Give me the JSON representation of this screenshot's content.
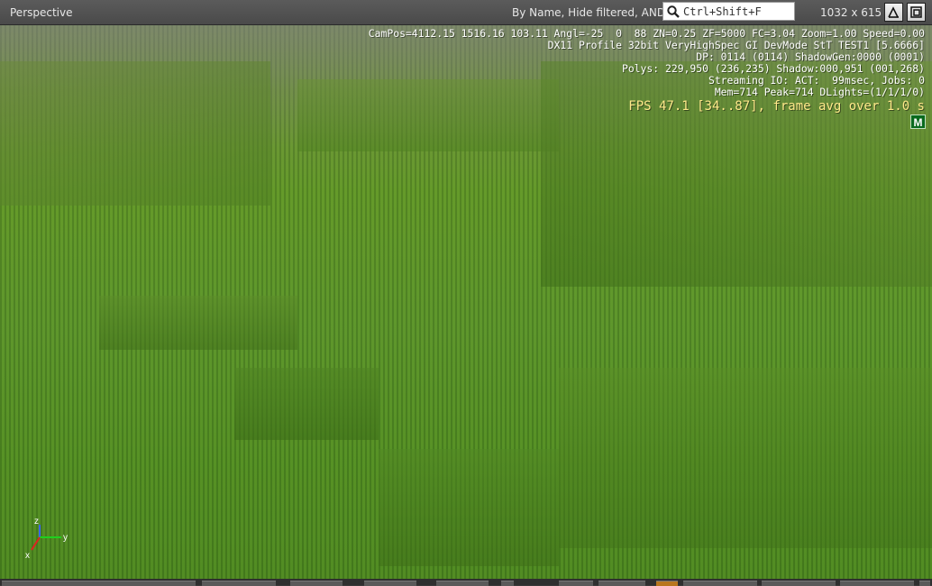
{
  "toolbar": {
    "view_title": "Perspective",
    "filter_mode": "By Name, Hide filtered, AND",
    "search_placeholder": "Ctrl+Shift+F",
    "resolution": "1032 x 615"
  },
  "hud": {
    "line1": "CamPos=4112.15 1516.16 103.11 Angl=-25  0  88 ZN=0.25 ZF=5000 FC=3.04 Zoom=1.00 Speed=0.00",
    "line2": "DX11 Profile 32bit VeryHighSpec GI DevMode StT TEST1 [5.6666]",
    "line3": "DP: 0114 (0114) ShadowGen:0000 (0001)",
    "line4": "Polys: 229,950 (236,235) Shadow:000,951 (001,268)",
    "line5": "Streaming IO: ACT:  99msec, Jobs: 0",
    "line6": "Mem=714 Peak=714 DLights=(1/1/1/0)",
    "fps": "FPS 47.1 [34..87], frame avg over 1.0 s",
    "badge": "M"
  },
  "axis_gizmo": {
    "z": "z",
    "y": "y",
    "x": "x"
  },
  "colors": {
    "grass": "#5f9528",
    "hud_text": "#ffffff",
    "fps_text": "#ffe98a",
    "badge_bg": "#0a6a1e"
  }
}
